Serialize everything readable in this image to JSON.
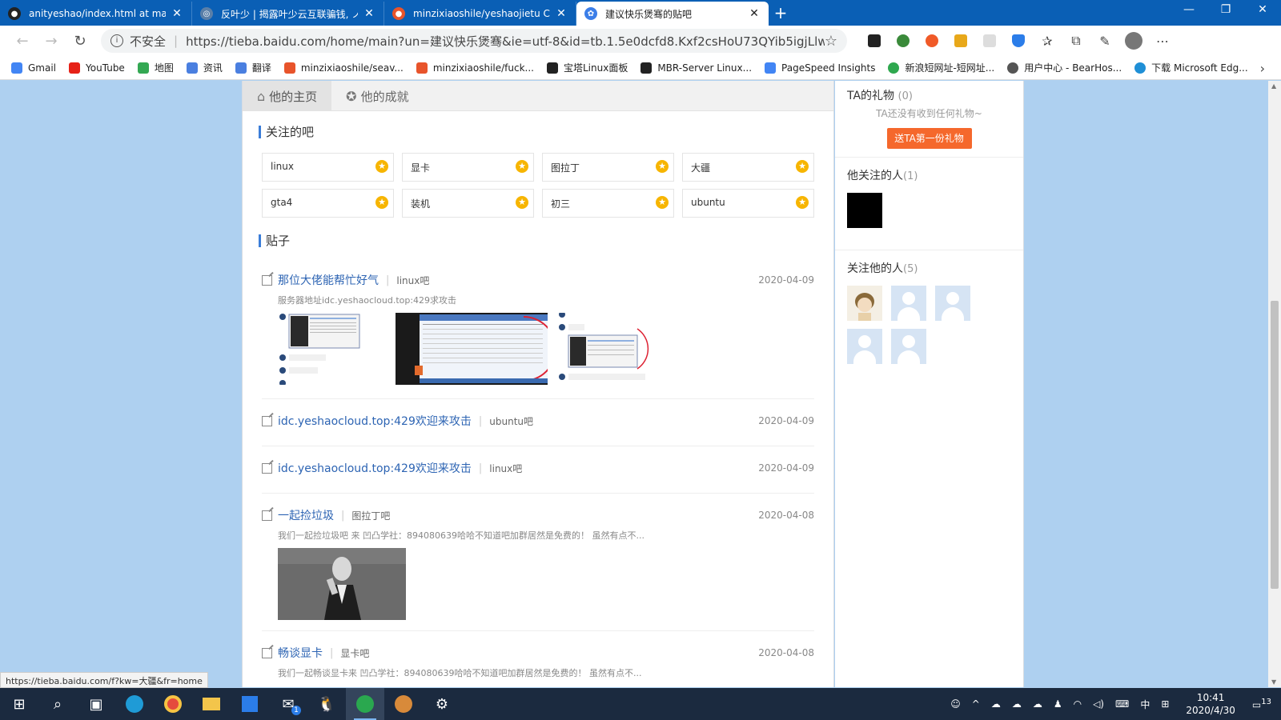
{
  "browser": {
    "tabs": [
      {
        "title": "anityeshao/index.html at master",
        "icon_color": "#222222",
        "icon": "github-icon"
      },
      {
        "title": "反叶少 | 揭露叶少云互联骗钱, ノ",
        "icon_color": "#5a7fa8",
        "icon": "site-icon"
      },
      {
        "title": "minzixiaoshile/yeshaojietu CDN",
        "icon_color": "#e8542b",
        "icon": "jsdelivr-icon"
      },
      {
        "title": "建议快乐煲骞的贴吧",
        "icon_color": "#3b7ee8",
        "icon": "baidu-paw-icon"
      }
    ],
    "new_tab": "+",
    "window_controls": [
      "—",
      "❐",
      "✕"
    ],
    "address": {
      "security_label": "不安全",
      "url": "https://tieba.baidu.com/home/main?un=建议快乐煲骞&ie=utf-8&id=tb.1.5e0dcfd8.Kxf2csHoU73QYib5igjLlw..."
    },
    "bookmarks": [
      {
        "label": "Gmail",
        "color": "#4285f4"
      },
      {
        "label": "YouTube",
        "color": "#e62117"
      },
      {
        "label": "地图",
        "color": "#34a853"
      },
      {
        "label": "资讯",
        "color": "#4a7fe0"
      },
      {
        "label": "翻译",
        "color": "#4a7fe0"
      },
      {
        "label": "minzixiaoshile/seav...",
        "color": "#e8542b"
      },
      {
        "label": "minzixiaoshile/fuck...",
        "color": "#e8542b"
      },
      {
        "label": "宝塔Linux面板",
        "color": "#222222"
      },
      {
        "label": "MBR-Server Linux...",
        "color": "#222222"
      },
      {
        "label": "PageSpeed Insights",
        "color": "#4285f4"
      },
      {
        "label": "新浪短网址-短网址...",
        "color": "#2fa84f"
      },
      {
        "label": "用户中心 - BearHos...",
        "color": "#555555"
      },
      {
        "label": "下载 Microsoft Edg...",
        "color": "#1f8fd6"
      }
    ]
  },
  "profile": {
    "tabs": [
      {
        "label": "他的主页",
        "icon": "home-icon"
      },
      {
        "label": "他的成就",
        "icon": "achievement-icon"
      }
    ],
    "followed_bars_title": "关注的吧",
    "followed_bars": [
      "linux",
      "显卡",
      "图拉丁",
      "大疆",
      "gta4",
      "装机",
      "初三",
      "ubuntu"
    ],
    "posts_title": "贴子",
    "posts": [
      {
        "title": "那位大佬能帮忙好气",
        "bar": "linux吧",
        "date": "2020-04-09",
        "desc": "服务器地址idc.yeshaocloud.top:429求攻击",
        "images": 3
      },
      {
        "title": "idc.yeshaocloud.top:429欢迎来攻击",
        "bar": "ubuntu吧",
        "date": "2020-04-09",
        "desc": "",
        "images": 0
      },
      {
        "title": "idc.yeshaocloud.top:429欢迎来攻击",
        "bar": "linux吧",
        "date": "2020-04-09",
        "desc": "",
        "images": 0
      },
      {
        "title": "一起捡垃圾",
        "bar": "图拉丁吧",
        "date": "2020-04-08",
        "desc": "我们一起捡垃圾吧 来 凹凸学社：894080639哈哈不知道吧加群居然是免费的！ 虽然有点不...",
        "images": 1
      },
      {
        "title": "畅谈显卡",
        "bar": "显卡吧",
        "date": "2020-04-08",
        "desc": "我们一起畅谈显卡来 凹凸学社：894080639哈哈不知道吧加群居然是免费的！ 虽然有点不...",
        "images": 0
      }
    ],
    "side": {
      "gifts_title": "TA的礼物",
      "gifts_count": "(0)",
      "no_gift_text": "TA还没有收到任何礼物~",
      "gift_button": "送TA第一份礼物",
      "following_title": "他关注的人",
      "following_count": "(1)",
      "followers_title": "关注他的人",
      "followers_count": "(5)"
    }
  },
  "status_url": "https://tieba.baidu.com/f?kw=大疆&fr=home",
  "taskbar": {
    "time": "10:41",
    "date": "2020/4/30",
    "ime": "中",
    "notification_count": "13",
    "mail_badge": "1"
  }
}
